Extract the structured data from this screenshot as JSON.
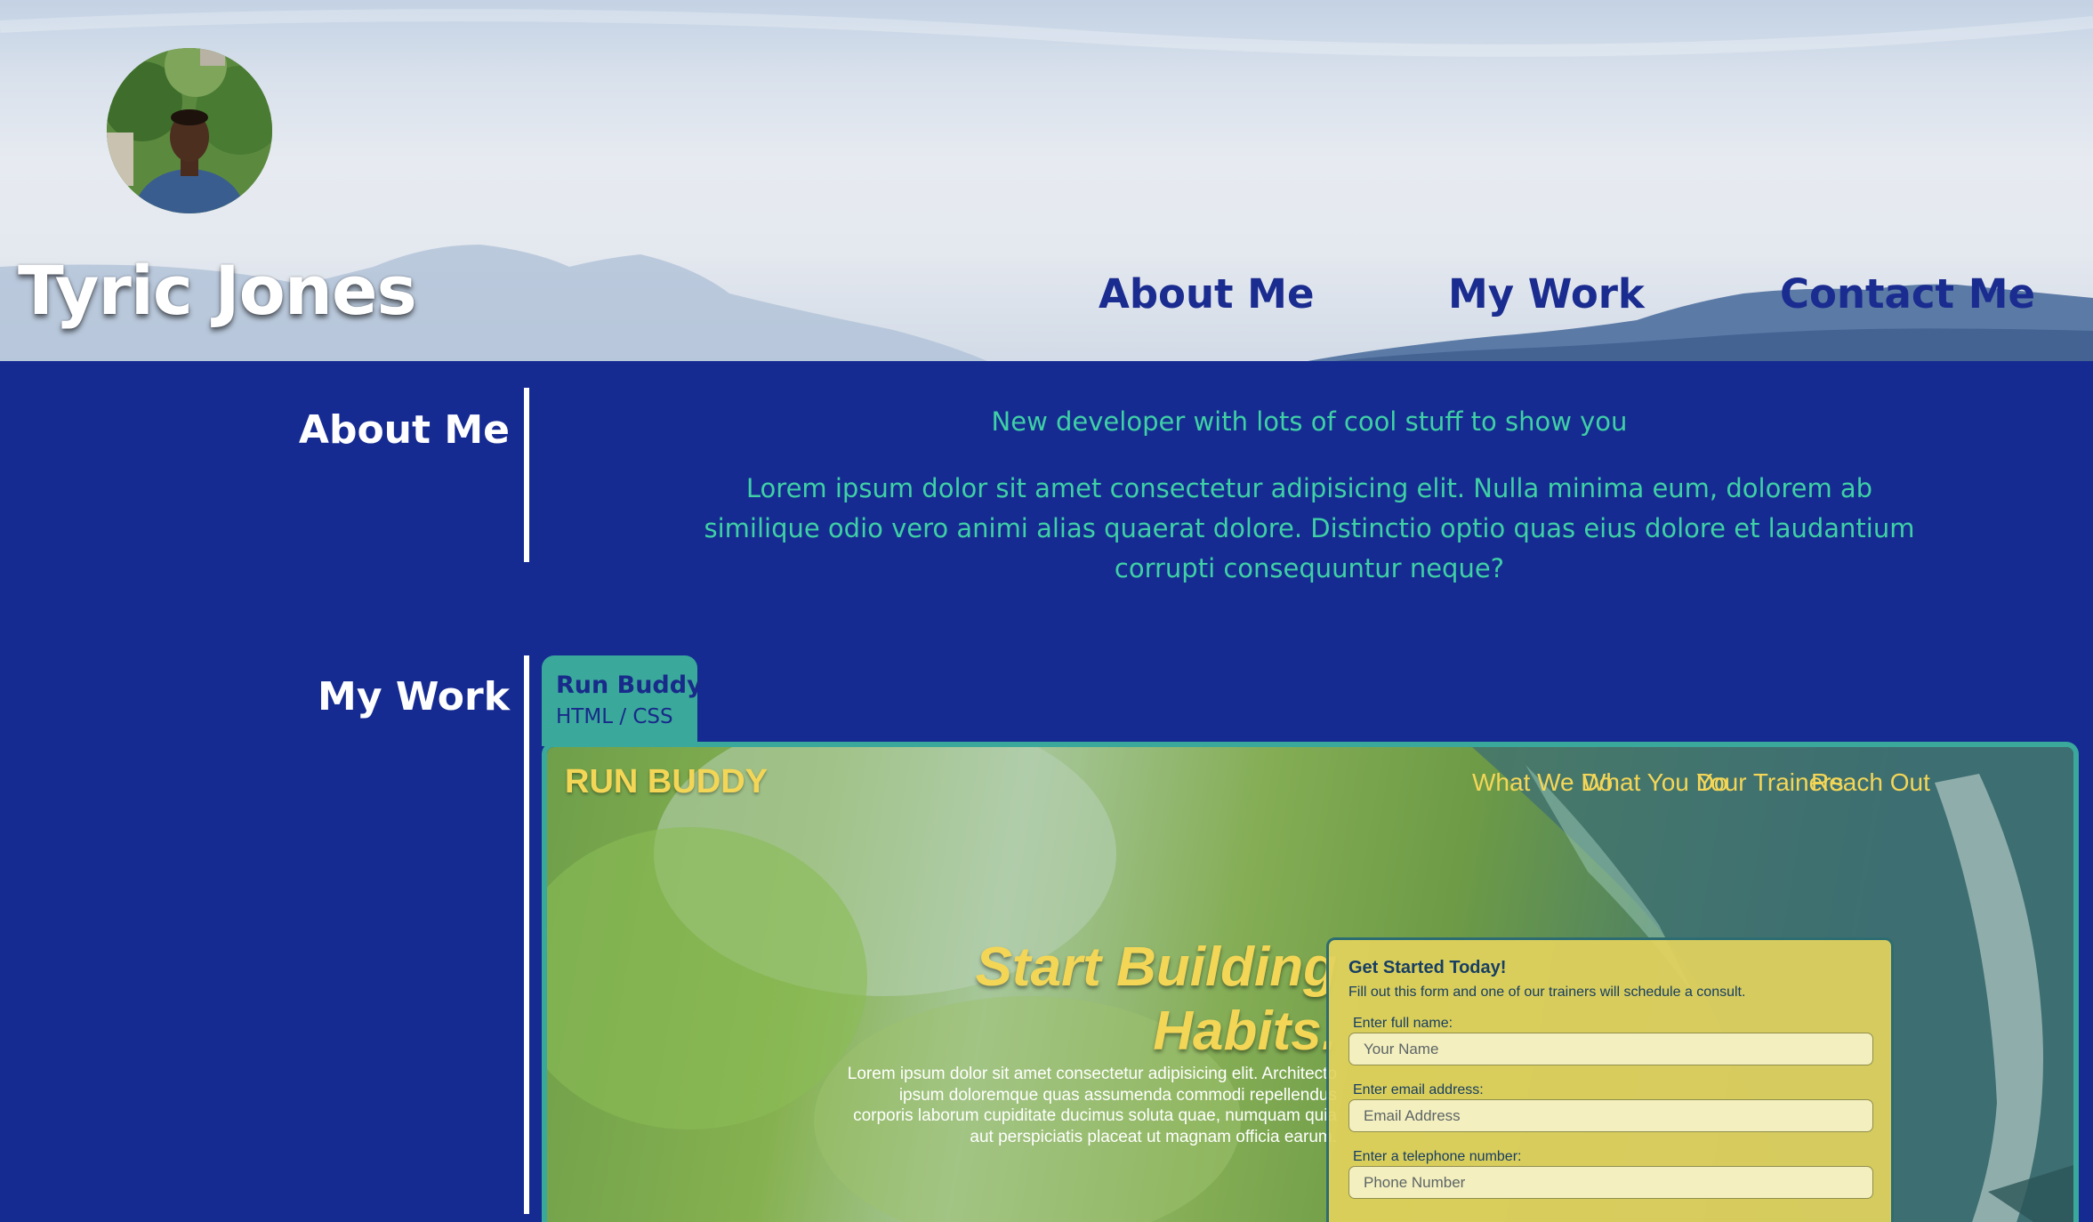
{
  "header": {
    "site_name": "Tyric Jones",
    "nav": [
      {
        "label": "About Me"
      },
      {
        "label": "My Work"
      },
      {
        "label": "Contact Me"
      }
    ]
  },
  "about": {
    "title": "About Me",
    "lead": "New developer with lots of cool stuff to show you",
    "body": "Lorem ipsum dolor sit amet consectetur adipisicing elit. Nulla minima eum, dolorem ab similique odio vero animi alias quaerat dolore. Distinctio optio quas eius dolore et laudantium corrupti consequuntur neque?"
  },
  "work": {
    "title": "My Work",
    "project": {
      "name": "Run Buddy",
      "tech": "HTML / CSS",
      "preview": {
        "brand": "RUN BUDDY",
        "nav": [
          "What We Do",
          "What You Do",
          "Your Trainers",
          "Reach Out"
        ],
        "hero_title_line1": "Start Building",
        "hero_title_line2": "Habits.",
        "hero_text": "Lorem ipsum dolor sit amet consectetur adipisicing elit. Architecto ipsum doloremque quas assumenda commodi repellendus corporis laborum cupiditate ducimus soluta quae, numquam quia aut perspiciatis placeat ut magnam officia earum.",
        "form": {
          "title": "Get Started Today!",
          "description": "Fill out this form and one of our trainers will schedule a consult.",
          "fields": [
            {
              "label": "Enter full name:",
              "placeholder": "Your Name"
            },
            {
              "label": "Enter email address:",
              "placeholder": "Email Address"
            },
            {
              "label": "Enter a telephone number:",
              "placeholder": "Phone Number"
            }
          ]
        }
      }
    }
  },
  "colors": {
    "page_background": "#162b92",
    "accent_teal": "#3fd0a5",
    "tab_teal": "#3aa89a",
    "nav_blue": "#1a2c8f",
    "runbuddy_yellow": "#f4d657"
  },
  "icons": {
    "avatar": "profile-photo"
  }
}
